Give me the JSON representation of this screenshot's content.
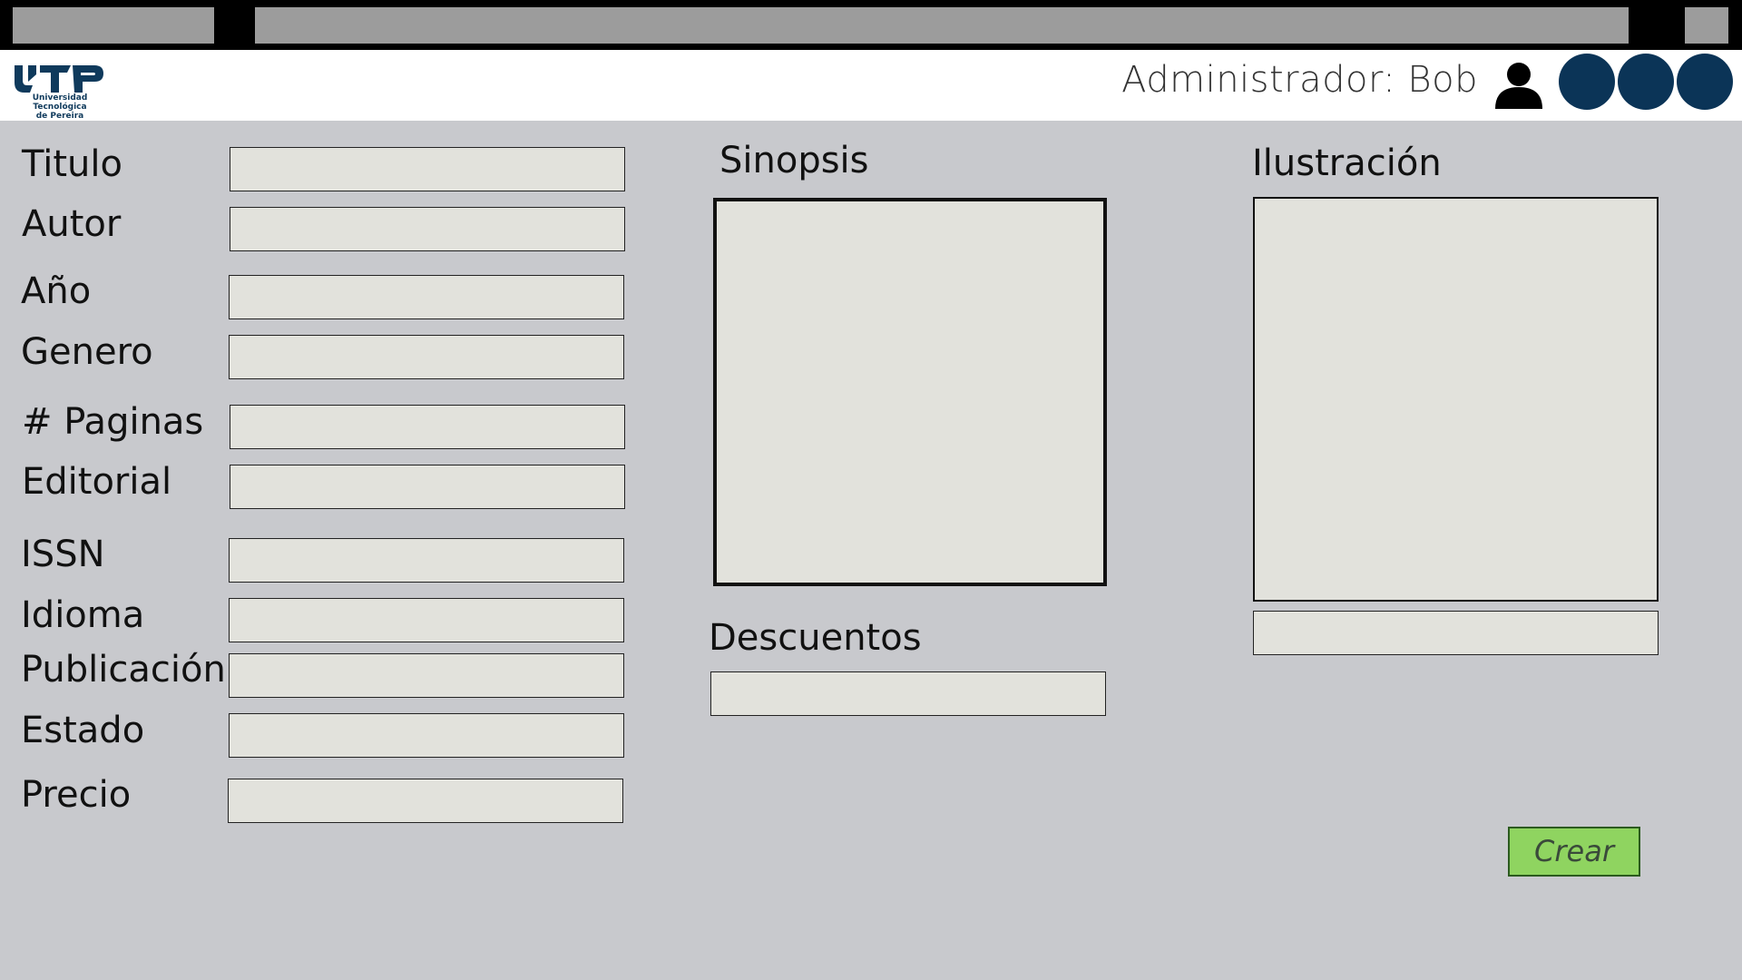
{
  "header": {
    "logo_text_line1": "Universidad Tecnológica",
    "logo_text_line2": "de Pereira",
    "admin_label": "Administrador: Bob"
  },
  "form": {
    "fields": [
      {
        "label": "Titulo",
        "value": ""
      },
      {
        "label": "Autor",
        "value": ""
      },
      {
        "label": "Año",
        "value": ""
      },
      {
        "label": "Genero",
        "value": ""
      },
      {
        "label": "# Paginas",
        "value": ""
      },
      {
        "label": "Editorial",
        "value": ""
      },
      {
        "label": "ISSN",
        "value": ""
      },
      {
        "label": "Idioma",
        "value": ""
      },
      {
        "label": "Publicación",
        "value": ""
      },
      {
        "label": "Estado",
        "value": ""
      },
      {
        "label": "Precio",
        "value": ""
      }
    ],
    "sinopsis_label": "Sinopsis",
    "descuentos_label": "Descuentos",
    "ilustracion_label": "Ilustración",
    "create_button": "Crear"
  },
  "colors": {
    "background": "#c8c9cd",
    "header_circles": "#0b3457",
    "create_button": "#8fd460"
  }
}
